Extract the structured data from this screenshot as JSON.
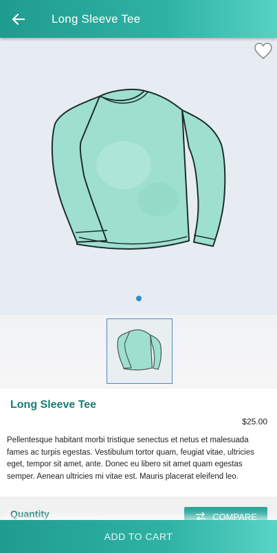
{
  "appbar": {
    "title": "Long Sleeve Tee",
    "back_icon": "arrow-left-icon"
  },
  "hero": {
    "favorite_icon": "heart-outline-icon",
    "image": "long-sleeve-tee-illustration",
    "pager_count": 1,
    "pager_active": 1
  },
  "thumbnails": [
    {
      "image": "long-sleeve-tee-thumbnail",
      "selected": true
    }
  ],
  "product": {
    "name": "Long Sleeve Tee",
    "price": "$25.00",
    "description": "Pellentesque habitant morbi tristique senectus et netus et malesuada fames ac turpis egestas. Vestibulum tortor quam, feugiat vitae, ultricies eget, tempor sit amet, ante. Donec eu libero sit amet quam egestas semper. Aenean ultricies mi vitae est. Mauris placerat eleifend leo."
  },
  "quantity": {
    "label": "Quantity"
  },
  "compare": {
    "label": "COMPARE",
    "icon": "compare-arrows-icon"
  },
  "cart": {
    "label": "ADD TO CART"
  },
  "colors": {
    "accent": "#2aa89b",
    "accent_dark": "#177c73",
    "pager": "#2c8fcc",
    "shirt": "#9fdfcf"
  }
}
